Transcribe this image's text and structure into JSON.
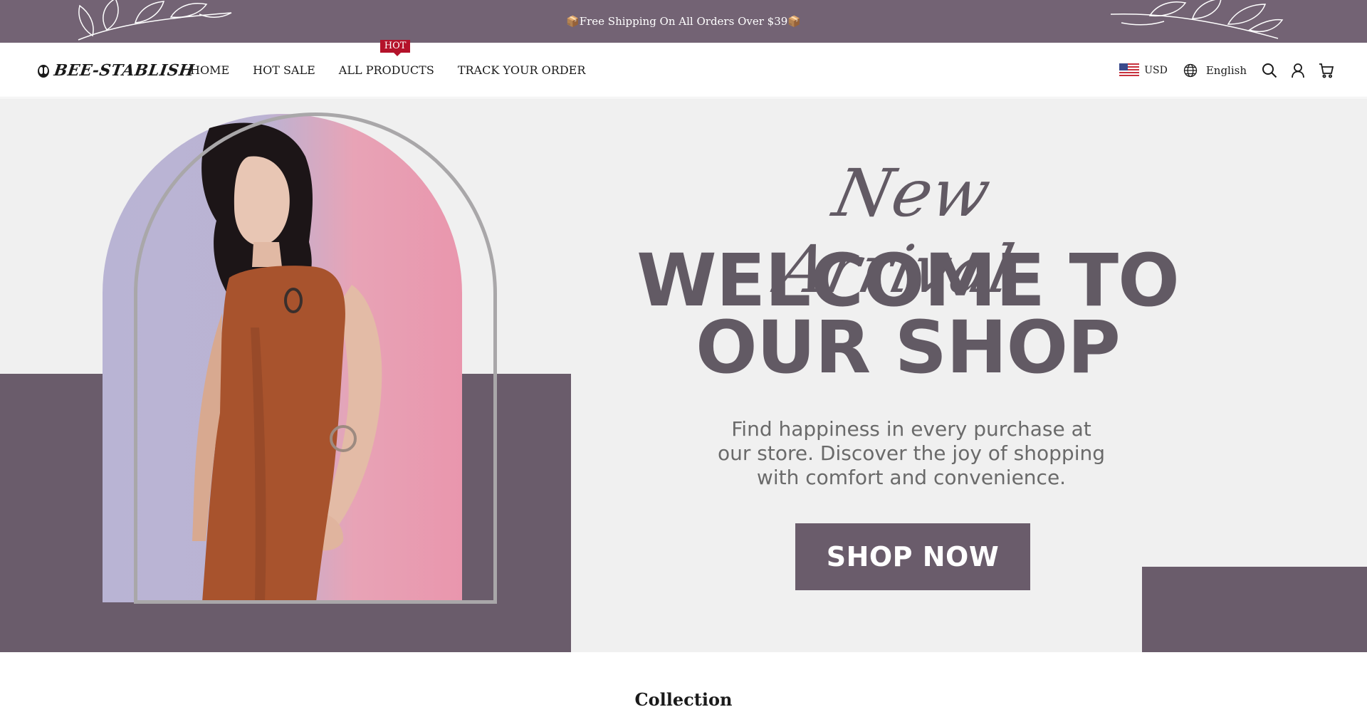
{
  "announcement": {
    "text": "📦Free Shipping On All Orders Over $39📦"
  },
  "header": {
    "logo_text": "BEE-STABLISH",
    "nav": [
      {
        "label": "HOME"
      },
      {
        "label": "HOT SALE"
      },
      {
        "label": "ALL PRODUCTS",
        "badge": "HOT"
      },
      {
        "label": "TRACK YOUR ORDER"
      }
    ],
    "currency": "USD",
    "currency_icon": "us-flag-icon",
    "language": "English",
    "language_icon": "globe-icon",
    "icons": [
      "search-icon",
      "account-icon",
      "cart-icon"
    ]
  },
  "hero": {
    "script_title": "New Arrival",
    "headline_line1": "WELCOME TO",
    "headline_line2": "OUR SHOP",
    "tagline_line1": "Find happiness in every purchase at",
    "tagline_line2": "our store. Discover the joy of shopping",
    "tagline_line3": "with comfort and convenience.",
    "cta": "SHOP NOW"
  },
  "collection": {
    "title": "Collection"
  },
  "colors": {
    "brand": "#736374",
    "hero_block": "#6a5c6b",
    "hero_bg": "#f0f0f0",
    "hot_badge": "#b4122a",
    "text": "#1a1a1a"
  }
}
